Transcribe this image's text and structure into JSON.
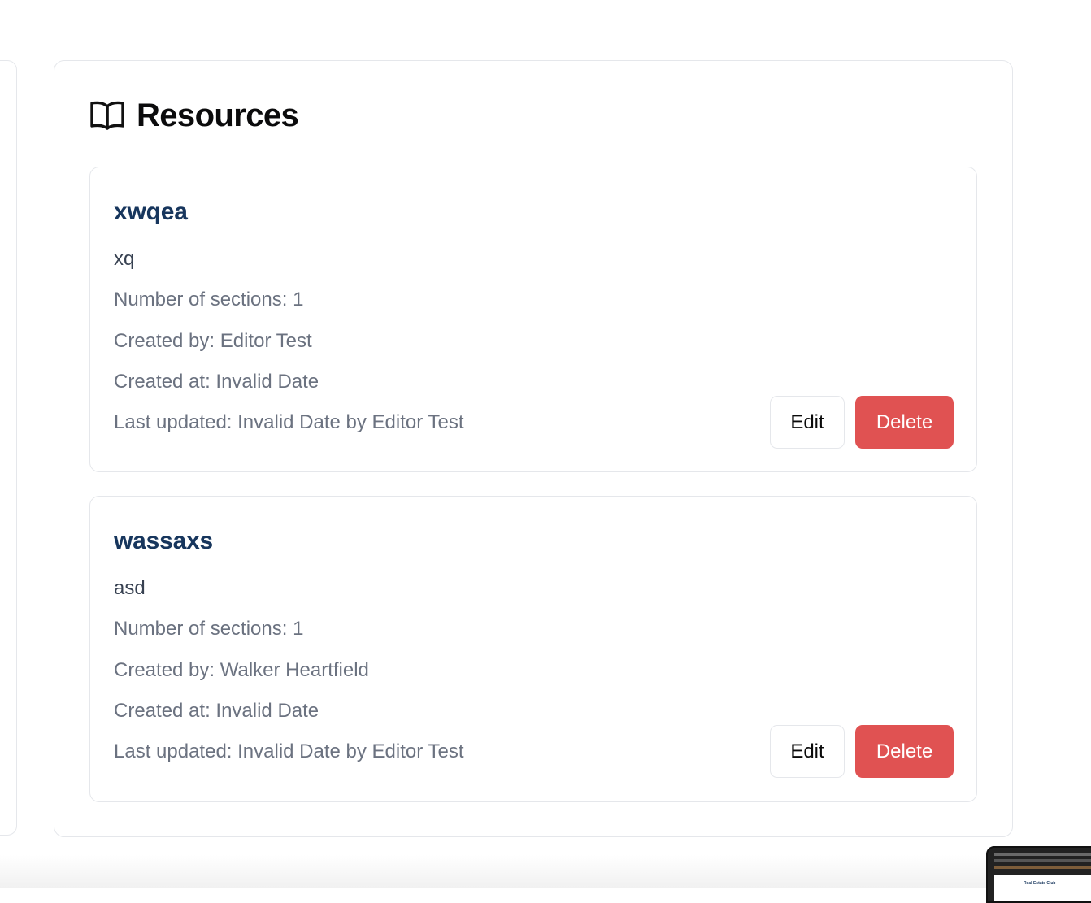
{
  "resources_section": {
    "title": "Resources",
    "icon": "book-open-icon"
  },
  "resources": [
    {
      "name": "xwqea",
      "description": "xq",
      "sections": "Number of sections: 1",
      "created_by": "Created by: Editor Test",
      "created_at": "Created at: Invalid Date",
      "last_updated": "Last updated: Invalid Date by Editor Test",
      "edit_label": "Edit",
      "delete_label": "Delete"
    },
    {
      "name": "wassaxs",
      "description": "asd",
      "sections": "Number of sections: 1",
      "created_by": "Created by: Walker Heartfield",
      "created_at": "Created at: Invalid Date",
      "last_updated": "Last updated: Invalid Date by Editor Test",
      "edit_label": "Edit",
      "delete_label": "Delete"
    }
  ],
  "colors": {
    "resource_name": "#17365d",
    "delete_button": "#e05252",
    "meta_text": "#6b7280",
    "border": "#e5e7eb"
  },
  "preview_thumbnail": {
    "text": "Real Estate Club"
  }
}
